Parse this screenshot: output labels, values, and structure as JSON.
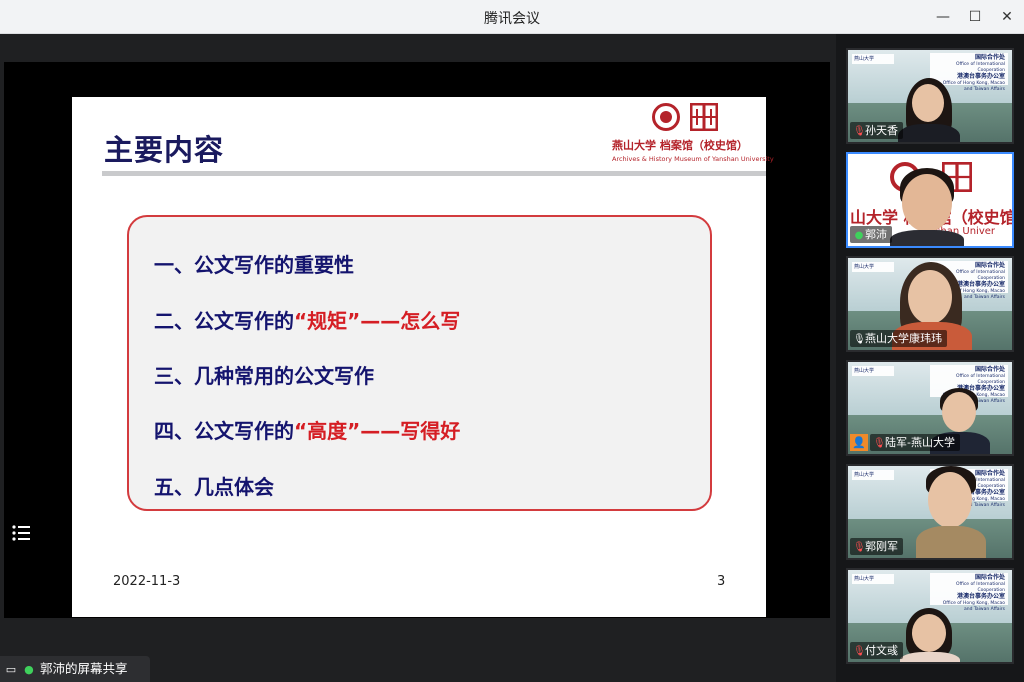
{
  "app": {
    "title": "腾讯会议",
    "controls": {
      "minimize": "—",
      "maximize": "☐",
      "close": "✕"
    }
  },
  "slide": {
    "title": "主要内容",
    "logo": {
      "cn": "燕山大学 档案馆（校史馆）",
      "en": "Archives & History Museum of Yanshan University"
    },
    "items": [
      {
        "prefix": "一、公文写作的重要性",
        "highlight": "",
        "suffix": ""
      },
      {
        "prefix": "二、公文写作的",
        "highlight": "“规矩”——怎么写",
        "suffix": ""
      },
      {
        "prefix": "三、几种常用的公文写作",
        "highlight": "",
        "suffix": ""
      },
      {
        "prefix": "四、公文写作的",
        "highlight": "“高度”——写得好",
        "suffix": ""
      },
      {
        "prefix": "五、几点体会",
        "highlight": "",
        "suffix": ""
      }
    ],
    "date": "2022-11-3",
    "page": "3"
  },
  "share": {
    "sharer_label": "郭沛的屏幕共享",
    "menu_icon": "list-icon"
  },
  "participants": [
    {
      "name": "孙天香",
      "mic": "off",
      "background": "board"
    },
    {
      "name": "郭沛",
      "mic": "on",
      "background": "slide",
      "active": true,
      "bg_text_cn": "山大学 档案馆（校史馆",
      "bg_text_en": "Yanshan Univer"
    },
    {
      "name": "燕山大学康玮玮",
      "mic": "on",
      "background": "board"
    },
    {
      "name": "陆军-燕山大学",
      "mic": "off",
      "background": "board",
      "avatar_badge": true
    },
    {
      "name": "郭刚军",
      "mic": "off",
      "background": "board"
    },
    {
      "name": "付文彧",
      "mic": "off",
      "background": "board"
    }
  ],
  "board_text": {
    "line1": "国际合作处",
    "line2": "Office of International Cooperation",
    "line3": "港澳台事务办公室",
    "line4": "Office of Hong Kong, Macao and Taiwan Affairs",
    "left": "燕山大学"
  },
  "colors": {
    "title_blue": "#1a1a5e",
    "item_blue": "#14146e",
    "accent_red": "#d51e24",
    "box_border": "#d33b3e",
    "active_border": "#3b8bff",
    "mic_on": "#3fd15c",
    "mic_off": "#ff4d4f"
  }
}
